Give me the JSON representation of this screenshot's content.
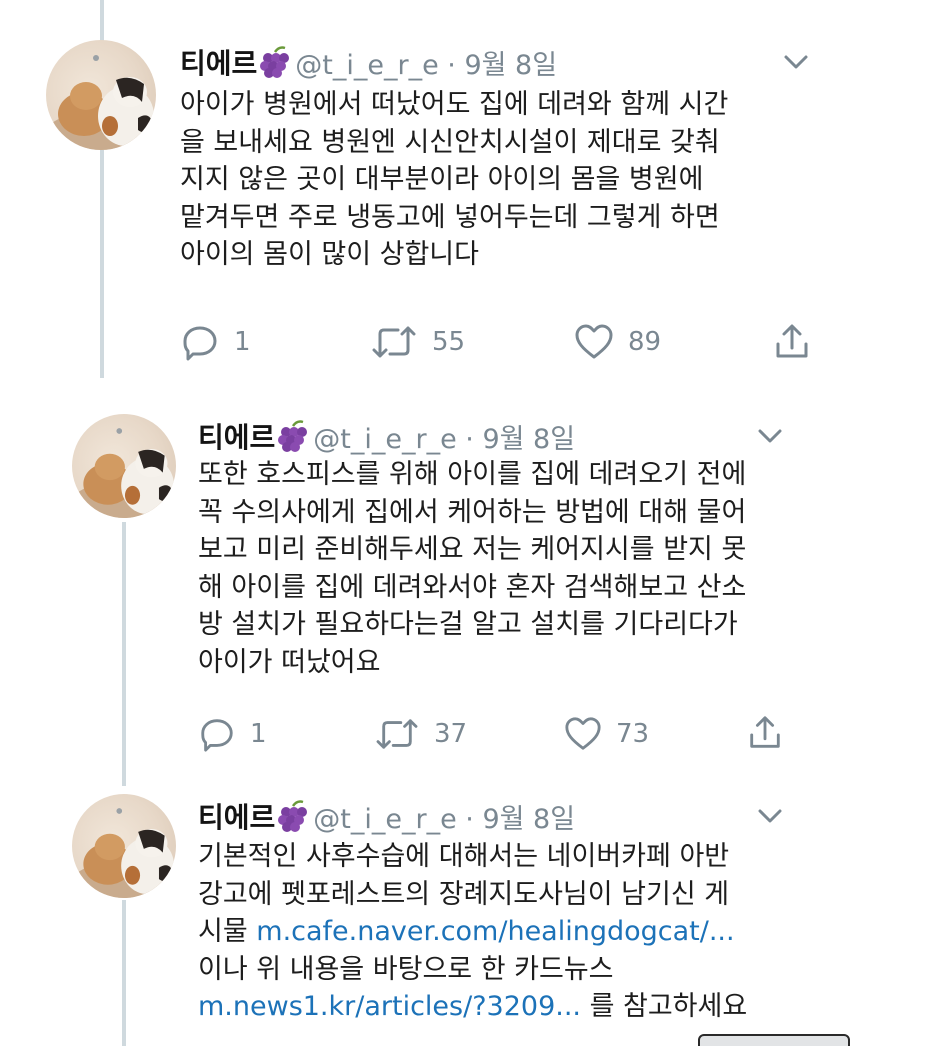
{
  "tweets": [
    {
      "name": "티에르",
      "handle_date": "@t_i_e_r_e · 9월 8일",
      "text_lines": [
        "아이가 병원에서 떠났어도 집에 데려와 함께 시간",
        "을 보내세요 병원엔 시신안치시설이 제대로 갖춰",
        "지지 않은 곳이 대부분이라 아이의 몸을 병원에",
        "맡겨두면 주로 냉동고에 넣어두는데 그렇게 하면",
        "아이의 몸이 많이 상합니다"
      ],
      "replies": "1",
      "retweets": "55",
      "likes": "89"
    },
    {
      "name": "티에르",
      "handle_date": "@t_i_e_r_e · 9월 8일",
      "text_lines": [
        "또한 호스피스를 위해 아이를 집에 데려오기 전에",
        "꼭 수의사에게 집에서 케어하는 방법에 대해 물어",
        "보고 미리 준비해두세요 저는 케어지시를 받지 못",
        "해 아이를 집에 데려와서야 혼자 검색해보고 산소",
        "방 설치가 필요하다는걸 알고 설치를 기다리다가",
        "아이가 떠났어요"
      ],
      "replies": "1",
      "retweets": "37",
      "likes": "73"
    },
    {
      "name": "티에르",
      "handle_date": "@t_i_e_r_e · 9월 8일",
      "line1": "기본적인 사후수습에 대해서는 네이버카페 아반",
      "line2": "강고에 펫포레스트의 장례지도사님이 남기신 게",
      "line3_prefix": "시물 ",
      "link1": "m.cafe.naver.com/healingdogcat/...",
      "line4": "이나 위 내용을 바탕으로 한 카드뉴스",
      "link2": "m.news1.kr/articles/?3209...",
      "line5_suffix": " 를 참고하세요"
    }
  ],
  "colors": {
    "link": "#1c72b8",
    "muted": "#7a8791",
    "thread_line": "#cfd9de"
  },
  "icons": [
    "reply-icon",
    "retweet-icon",
    "like-icon",
    "share-icon",
    "chevron-down-icon",
    "grape-emoji-icon"
  ]
}
